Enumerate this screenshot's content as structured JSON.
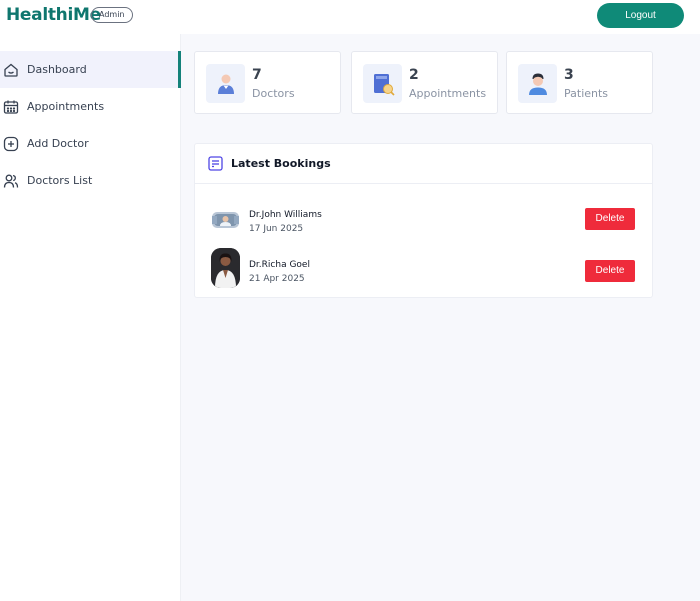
{
  "header": {
    "brand": "HealthiMe",
    "badge": "Admin",
    "logout_label": "Logout"
  },
  "sidebar": {
    "items": [
      {
        "label": "Dashboard",
        "icon": "home-icon",
        "active": true
      },
      {
        "label": "Appointments",
        "icon": "calendar-icon",
        "active": false
      },
      {
        "label": "Add Doctor",
        "icon": "add-icon",
        "active": false
      },
      {
        "label": "Doctors List",
        "icon": "people-icon",
        "active": false
      }
    ]
  },
  "stats": [
    {
      "value": "7",
      "label": "Doctors",
      "icon": "doctor-icon"
    },
    {
      "value": "2",
      "label": "Appointments",
      "icon": "appointment-book-icon"
    },
    {
      "value": "3",
      "label": "Patients",
      "icon": "patient-icon"
    }
  ],
  "bookings": {
    "title": "Latest Bookings",
    "rows": [
      {
        "name": "Dr.John Williams",
        "date": "17 Jun 2025",
        "action": "Delete"
      },
      {
        "name": "Dr.Richa Goel",
        "date": "21 Apr 2025",
        "action": "Delete"
      }
    ]
  },
  "colors": {
    "brand": "#0f766e",
    "logout": "#0f8a78",
    "delete": "#ef2b3b",
    "active_sidebar_bg": "#f1f2fc"
  }
}
